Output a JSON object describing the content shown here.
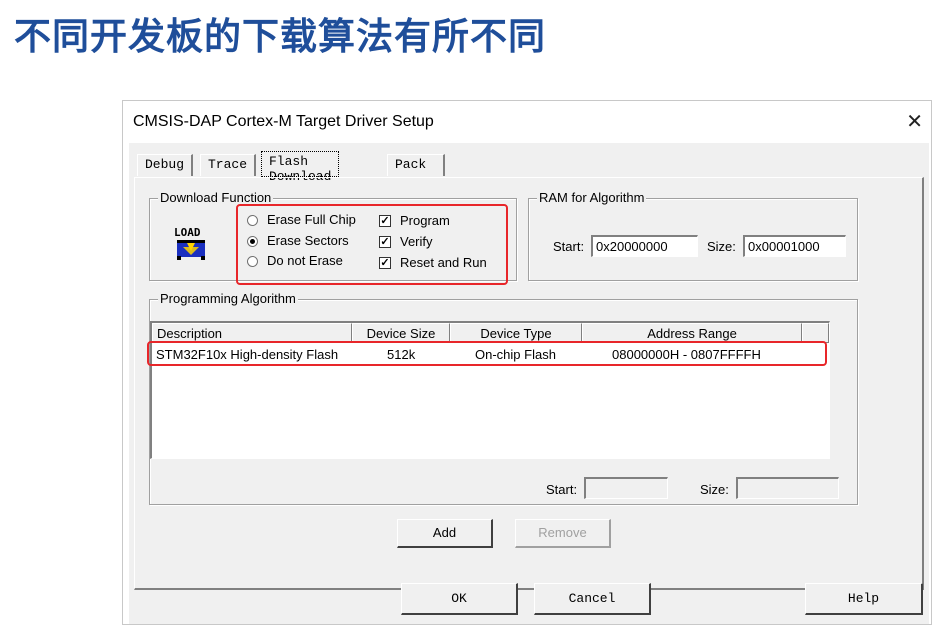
{
  "slide_title": "不同开发板的下载算法有所不同",
  "window": {
    "title": "CMSIS-DAP Cortex-M Target Driver Setup",
    "close_icon": "close-icon"
  },
  "tabs": [
    {
      "label": "Debug",
      "active": false
    },
    {
      "label": "Trace",
      "active": false
    },
    {
      "label": "Flash Download",
      "active": true
    },
    {
      "label": "Pack",
      "active": false
    }
  ],
  "download_function": {
    "label": "Download Function",
    "icon_text": "LOAD",
    "radios": [
      {
        "label": "Erase Full Chip",
        "selected": false
      },
      {
        "label": "Erase Sectors",
        "selected": true
      },
      {
        "label": "Do not Erase",
        "selected": false
      }
    ],
    "checks": [
      {
        "label": "Program",
        "checked": true
      },
      {
        "label": "Verify",
        "checked": true
      },
      {
        "label": "Reset and Run",
        "checked": true
      }
    ]
  },
  "ram": {
    "label": "RAM for Algorithm",
    "start_label": "Start:",
    "start_value": "0x20000000",
    "size_label": "Size:",
    "size_value": "0x00001000"
  },
  "programming_algorithm": {
    "label": "Programming Algorithm",
    "columns": [
      "Description",
      "Device Size",
      "Device Type",
      "Address Range"
    ],
    "rows": [
      {
        "description": "STM32F10x High-density Flash",
        "device_size": "512k",
        "device_type": "On-chip Flash",
        "address_range": "08000000H - 0807FFFFH"
      }
    ],
    "start_label": "Start:",
    "start_value": "",
    "size_label": "Size:",
    "size_value": ""
  },
  "buttons": {
    "add": "Add",
    "remove": "Remove",
    "ok": "OK",
    "cancel": "Cancel",
    "help": "Help"
  },
  "colors": {
    "title_blue": "#1f4e9a",
    "highlight_red": "#e8262a"
  }
}
